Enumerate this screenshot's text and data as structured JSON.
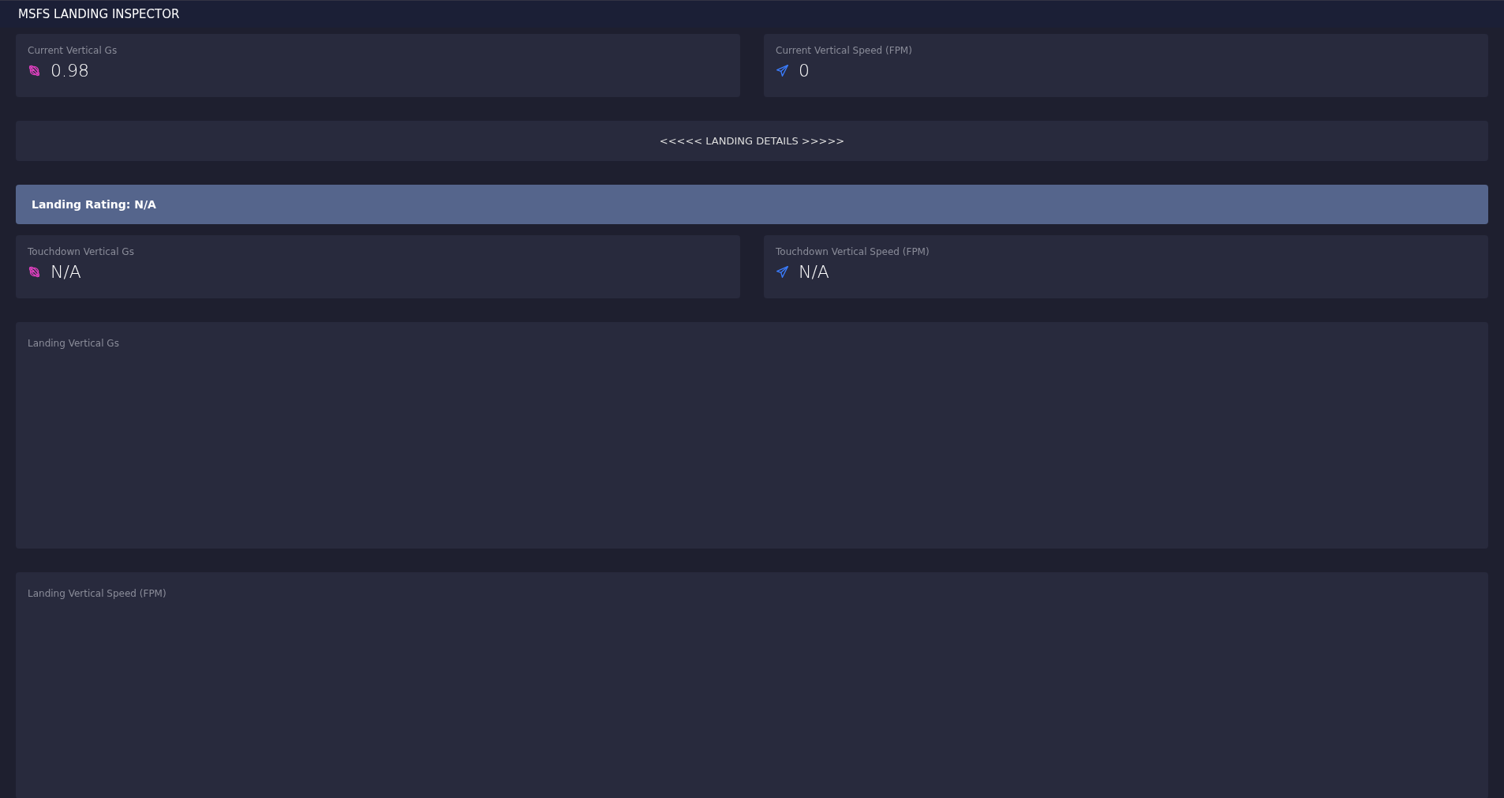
{
  "app_title": "MSFS LANDING INSPECTOR",
  "current": [
    {
      "kind": "gs",
      "label": "Current Vertical Gs",
      "value": "0.98"
    },
    {
      "kind": "speed",
      "label": "Current Vertical Speed (FPM)",
      "value": "0"
    }
  ],
  "details_banner": "<<<<< LANDING DETAILS >>>>>",
  "rating": "Landing Rating: N/A",
  "touchdown": [
    {
      "kind": "gs",
      "label": "Touchdown Vertical Gs",
      "value": "N/A"
    },
    {
      "kind": "speed",
      "label": "Touchdown Vertical Speed (FPM)",
      "value": "N/A"
    }
  ],
  "panels": [
    {
      "title": "Landing Vertical Gs"
    },
    {
      "title": "Landing Vertical Speed (FPM)"
    }
  ]
}
